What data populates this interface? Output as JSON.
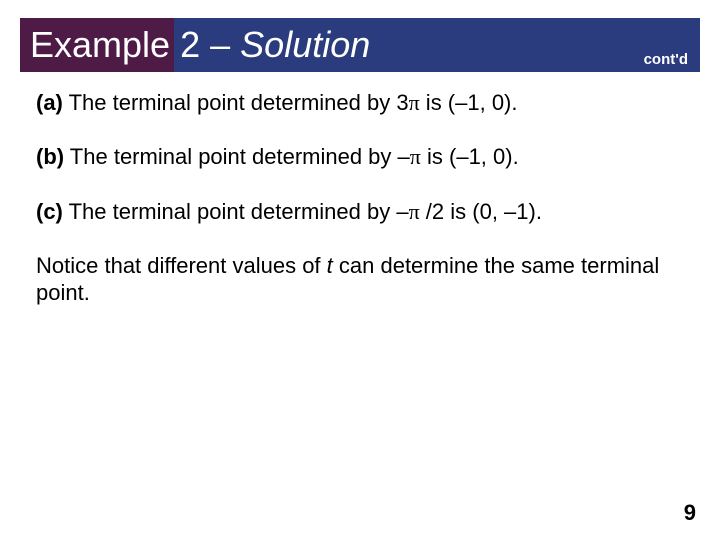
{
  "title": {
    "badge": "Example",
    "number": "2",
    "dash": "–",
    "word": "Solution",
    "contd": "cont'd"
  },
  "lines": {
    "a_label": "(a)",
    "a_text1": " The terminal point determined by 3",
    "a_pi": "π",
    "a_text2": " is (–1, 0).",
    "b_label": "(b)",
    "b_text1": " The terminal point determined by –",
    "b_pi": "π",
    "b_text2": " is (–1, 0).",
    "c_label": "(c)",
    "c_text1": " The terminal point determined by –",
    "c_pi": "π",
    "c_text2": " /2 is (0, –1).",
    "note1": "Notice that different values of ",
    "note_t": "t",
    "note2": " can determine the same terminal point."
  },
  "page": "9"
}
